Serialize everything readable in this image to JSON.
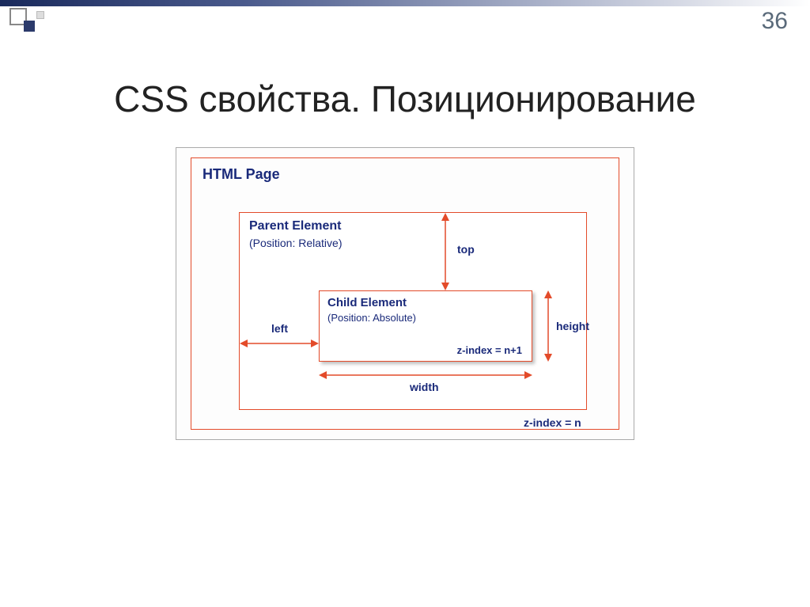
{
  "slide": {
    "number": "36",
    "title": "CSS свойства. Позиционирование"
  },
  "diagram": {
    "page_label": "HTML Page",
    "parent": {
      "title": "Parent Element",
      "subtitle": "(Position: Relative)",
      "zindex": "z-index = n"
    },
    "child": {
      "title": "Child Element",
      "subtitle": "(Position: Absolute)",
      "zindex": "z-index = n+1"
    },
    "labels": {
      "top": "top",
      "left": "left",
      "width": "width",
      "height": "height"
    }
  }
}
